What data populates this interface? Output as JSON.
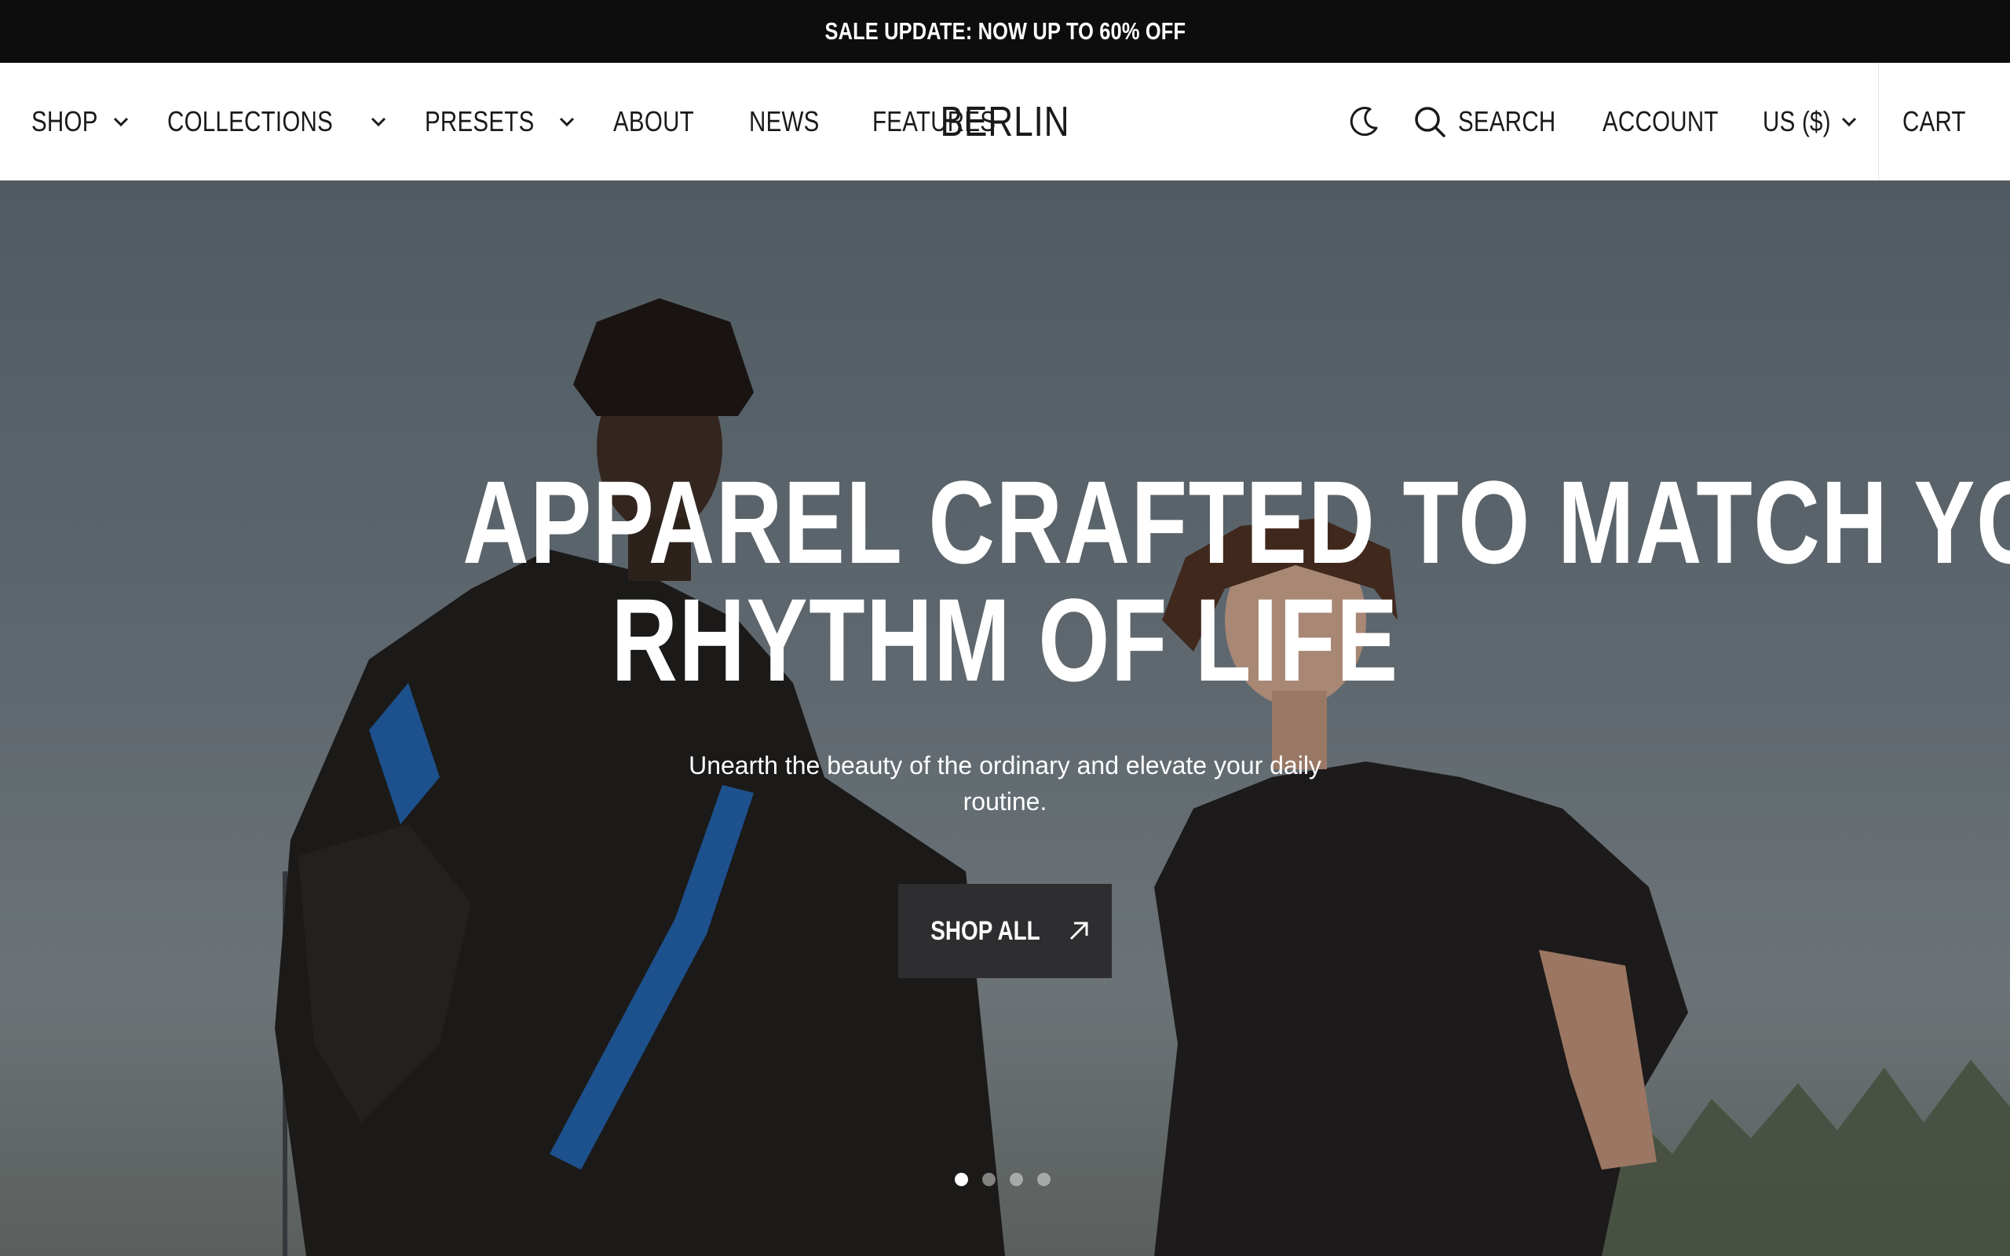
{
  "announcement": {
    "text": "SALE UPDATE: NOW UP TO 60% OFF"
  },
  "header": {
    "nav": [
      {
        "label": "SHOP",
        "has_dropdown": true
      },
      {
        "label": "COLLECTIONS",
        "has_dropdown": true
      },
      {
        "label": "PRESETS",
        "has_dropdown": true
      },
      {
        "label": "ABOUT",
        "has_dropdown": false
      },
      {
        "label": "NEWS",
        "has_dropdown": false
      },
      {
        "label": "FEATURES",
        "has_dropdown": false
      }
    ],
    "logo": "BERLIN",
    "theme_toggle_icon": "moon-icon",
    "search_label": "SEARCH",
    "account_label": "ACCOUNT",
    "currency_label": "US ($)",
    "cart_label": "CART"
  },
  "hero": {
    "title_line1": "APPAREL CRAFTED TO MATCH YOUR",
    "title_line2": "RHYTHM OF LIFE",
    "subtitle": "Unearth the beauty of the ordinary and elevate your daily routine.",
    "cta_label": "SHOP ALL",
    "cta_icon": "arrow-up-right-icon",
    "slides_count": 4,
    "active_slide": 1
  },
  "colors": {
    "announcement_bg": "#0d0d0d",
    "header_bg": "#ffffff",
    "text_dark": "#1a1a1a",
    "cta_bg": "#2e2e30"
  }
}
